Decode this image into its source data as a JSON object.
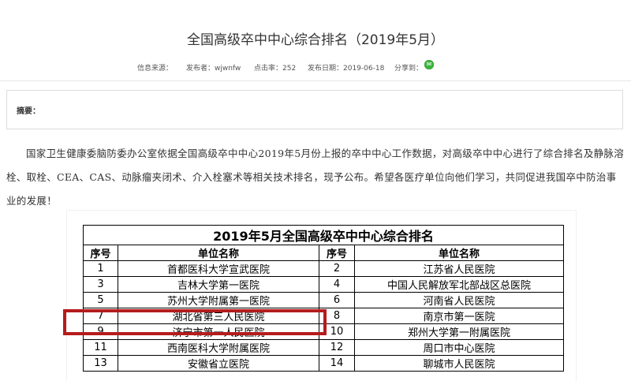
{
  "article": {
    "title": "全国高级卒中中心综合排名（2019年5月）",
    "meta": {
      "source_label": "信息来源：",
      "publisher": "发布者：wjwnfw",
      "hits": "点击率：252",
      "date": "发布日期：2019-06-18",
      "share_label": "分享到："
    },
    "share_icons": [
      "favorite-icon",
      "weibo-icon",
      "qzone-icon",
      "pinterest-icon",
      "renren-icon",
      "wechat-icon"
    ],
    "abstract_label": "摘要：",
    "paragraph": "国家卫生健康委脑防委办公室依据全国高级卒中中心2019年5月份上报的卒中中心工作数据，对高级卒中中心进行了综合排名及静脉溶栓、取栓、CEA、CAS、动脉瘤夹闭术、介入栓塞术等相关技术排名，现予公布。希望各医疗单位向他们学习，共同促进我国卒中防治事业的发展！"
  },
  "table": {
    "title": "2019年5月全国高级卒中中心综合排名",
    "headers": [
      "序号",
      "单位名称",
      "序号",
      "单位名称"
    ],
    "rows": [
      [
        "1",
        "首都医科大学宣武医院",
        "2",
        "江苏省人民医院"
      ],
      [
        "3",
        "吉林大学第一医院",
        "4",
        "中国人民解放军北部战区总医院"
      ],
      [
        "5",
        "苏州大学附属第一医院",
        "6",
        "河南省人民医院"
      ],
      [
        "7",
        "湖北省第三人民医院",
        "8",
        "南京市第一医院"
      ],
      [
        "9",
        "济宁市第一人民医院",
        "10",
        "郑州大学第一附属医院"
      ],
      [
        "11",
        "西南医科大学附属医院",
        "12",
        "周口市中心医院"
      ],
      [
        "13",
        "安徽省立医院",
        "14",
        "聊城市人民医院"
      ]
    ]
  },
  "colors": {
    "highlight": "#b51c1c",
    "share": [
      "#f5a623",
      "#e6162d",
      "#f5b400",
      "#cb2027",
      "#2a6fd6",
      "#3bb33b"
    ]
  }
}
